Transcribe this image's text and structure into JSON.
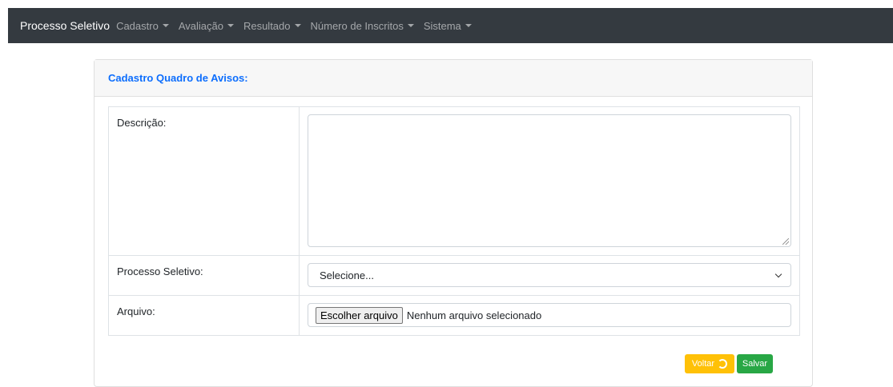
{
  "navbar": {
    "brand": "Processo Seletivo",
    "items": [
      {
        "label": "Cadastro"
      },
      {
        "label": "Avaliação"
      },
      {
        "label": "Resultado"
      },
      {
        "label": "Número de Inscritos"
      },
      {
        "label": "Sistema"
      }
    ],
    "icons": {
      "dropdown": "caret-down-icon"
    }
  },
  "card": {
    "title": "Cadastro Quadro de Avisos:"
  },
  "form": {
    "descricao_label": "Descrição:",
    "descricao_value": "",
    "processo_label": "Processo Seletivo:",
    "processo_selected": "Selecione...",
    "arquivo_label": "Arquivo:",
    "arquivo_button": "Escolher arquivo",
    "arquivo_status": "Nenhum arquivo selecionado"
  },
  "actions": {
    "voltar_label": "Voltar",
    "salvar_label": "Salvar",
    "voltar_icon": "undo-icon"
  },
  "colors": {
    "navbar_bg": "#343a40",
    "title": "#0d6efd",
    "voltar": "#ffc107",
    "salvar": "#28a745"
  }
}
